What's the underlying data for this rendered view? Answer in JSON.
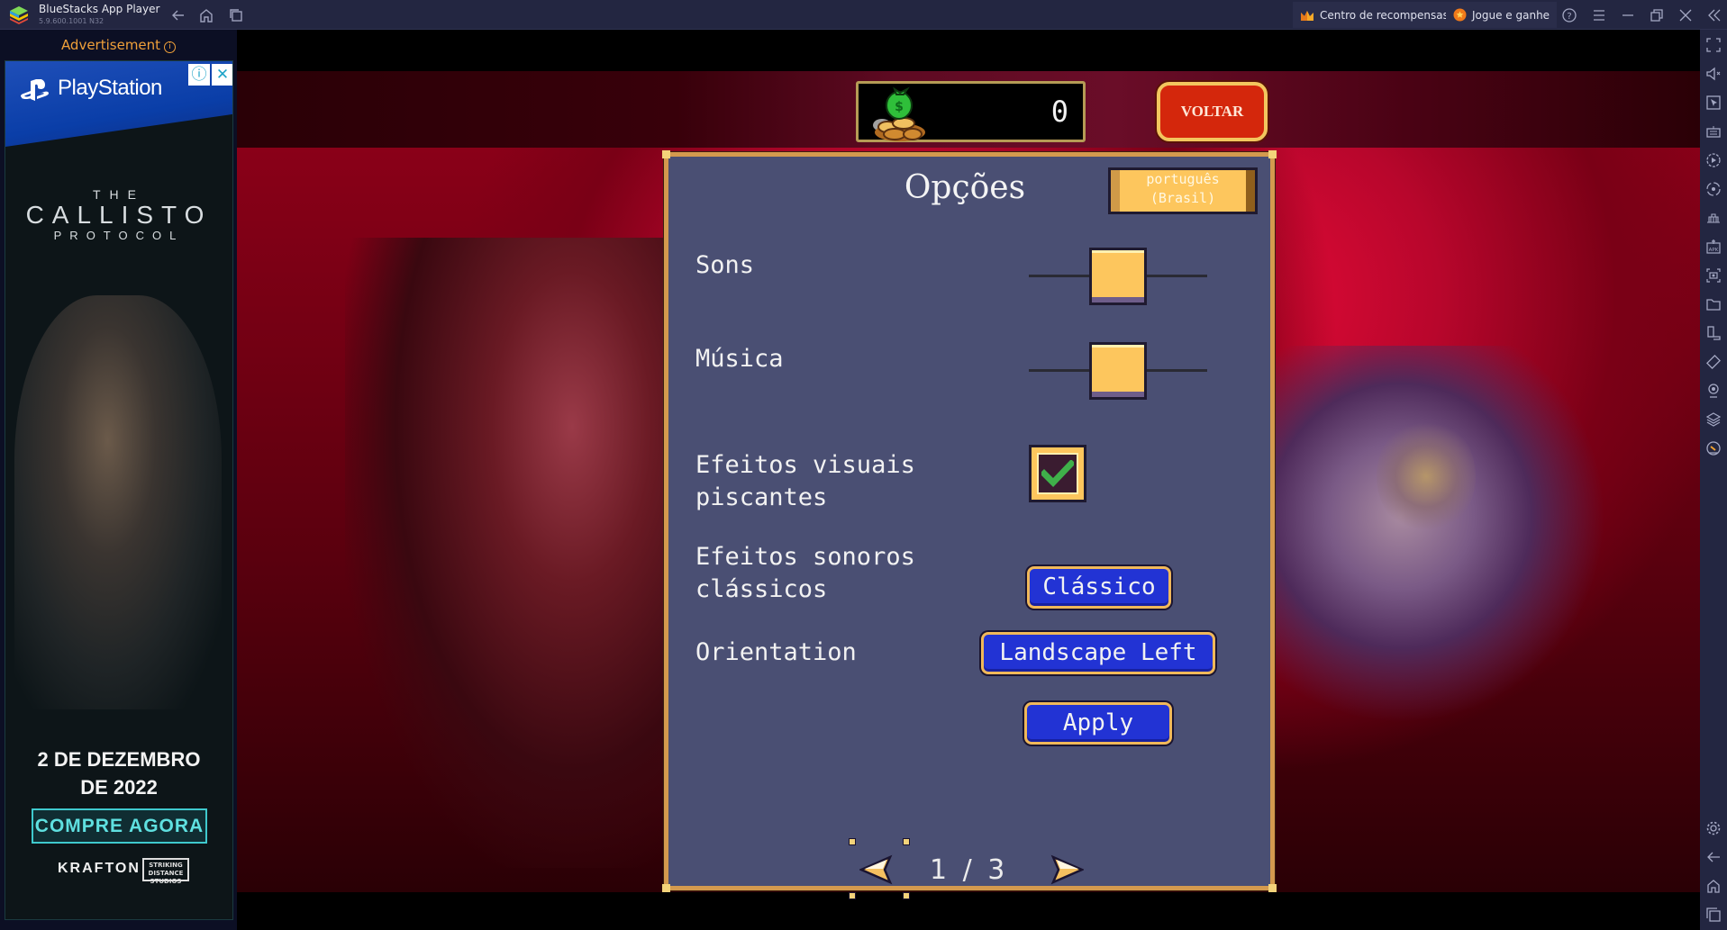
{
  "window": {
    "app_title": "BlueStacks App Player",
    "version": "5.9.600.1001 N32",
    "rewards_label": "Centro de recompensas",
    "play_earn_label": "Jogue e ganhe",
    "nav_icons": [
      "back-arrow-icon",
      "home-icon",
      "recent-apps-icon"
    ],
    "window_icons": [
      "help-icon",
      "menu-icon",
      "minimize-icon",
      "restore-icon",
      "close-icon",
      "collapse-sidebar-icon"
    ]
  },
  "ad": {
    "label": "Advertisement",
    "brand": "PlayStation",
    "title_line1": "THE",
    "title_line2": "CALLISTO",
    "title_line3": "PROTOCOL",
    "date_line1": "2 DE DEZEMBRO",
    "date_line2": "DE 2022",
    "cta": "COMPRE AGORA",
    "publisher": "KRAFTON",
    "studio": "STRIKING DISTANCE STUDIOS"
  },
  "game": {
    "gold": "0",
    "back_label": "VOLTAR",
    "colors": {
      "panel_bg": "#4a4f73",
      "panel_border": "#d49a4e",
      "button_blue": "#2233d4",
      "thumb_gold": "#fdc65d",
      "back_red": "#d4270c"
    },
    "options": {
      "title": "Opções",
      "language": "português (Brasil)",
      "language_line1": "português",
      "language_line2": "(Brasil)",
      "sounds_label": "Sons",
      "sounds_value": 0.5,
      "music_label": "Música",
      "music_value": 0.5,
      "flash_label_line1": "Efeitos visuais",
      "flash_label_line2": "piscantes",
      "flash_checked": true,
      "classic_sfx_label_line1": "Efeitos sonoros",
      "classic_sfx_label_line2": "clássicos",
      "classic_sfx_value": "Clássico",
      "orientation_label": "Orientation",
      "orientation_value": "Landscape Left",
      "apply_label": "Apply",
      "page_current": "1",
      "page_total": "3",
      "page_text": "1 / 3"
    }
  },
  "sidebar": {
    "icons": [
      "fullscreen-icon",
      "volume-mute-icon",
      "pointer-icon",
      "keyboard-icon",
      "macro-record-icon",
      "sync-icon",
      "multi-instance-icon",
      "install-apk-icon",
      "screenshot-icon",
      "folder-icon",
      "rotate-icon",
      "shake-icon",
      "location-icon",
      "layers-icon",
      "performance-icon"
    ],
    "bottom_icons": [
      "settings-icon",
      "back-icon",
      "home-icon",
      "recent-apps-icon"
    ]
  }
}
